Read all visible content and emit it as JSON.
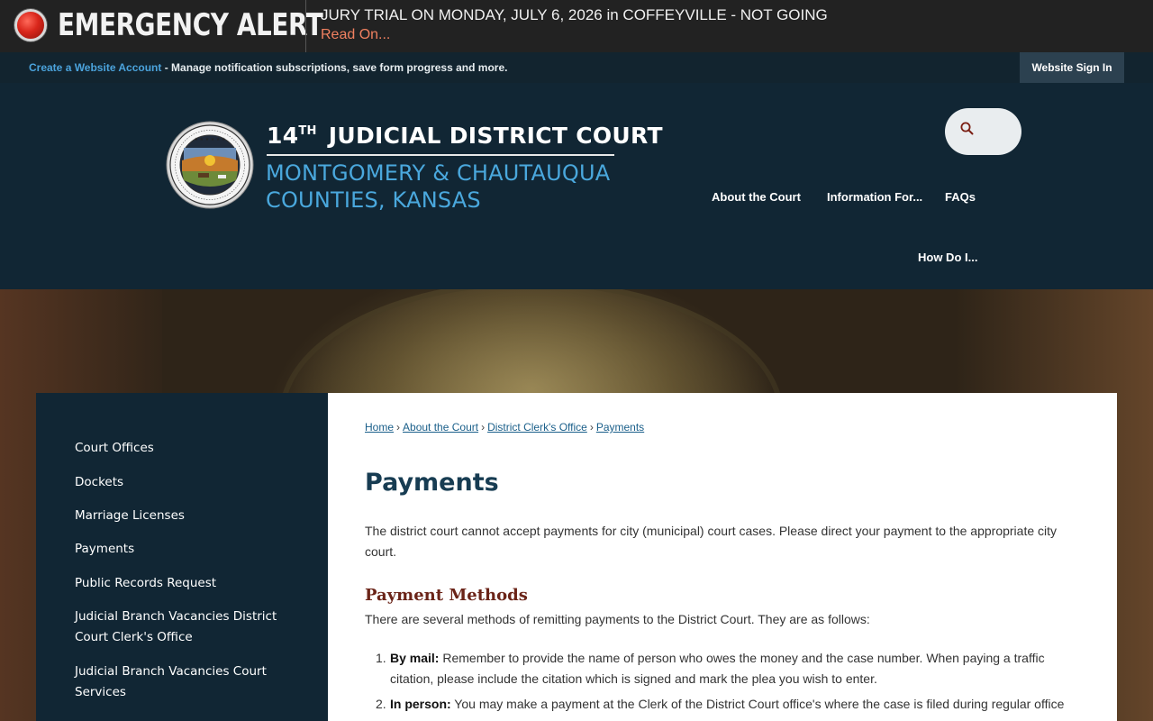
{
  "alert": {
    "title": "EMERGENCY ALERT",
    "headline": "JURY TRIAL ON MONDAY, JULY 6, 2026 in COFFEYVILLE - NOT GOING",
    "read_on": "Read On..."
  },
  "account_bar": {
    "create_link": "Create a Website Account",
    "description": " - Manage notification subscriptions, save form progress and more.",
    "sign_in": "Website Sign In"
  },
  "header": {
    "title_number": "14",
    "title_superscript": "TH",
    "title_rest": "JUDICIAL DISTRICT COURT",
    "county_line_1": "MONTGOMERY & CHAUTAUQUA",
    "county_line_2": "COUNTIES, KANSAS",
    "nav": [
      {
        "label": "About the Court"
      },
      {
        "label": "Information For..."
      },
      {
        "label": "FAQs"
      },
      {
        "label": "How Do I..."
      }
    ]
  },
  "sidebar": {
    "items": [
      {
        "label": "Court Offices"
      },
      {
        "label": "Dockets"
      },
      {
        "label": "Marriage Licenses"
      },
      {
        "label": "Payments"
      },
      {
        "label": "Public Records Request"
      },
      {
        "label": "Judicial Branch Vacancies District Court Clerk's Office"
      },
      {
        "label": "Judicial Branch Vacancies Court Services"
      }
    ]
  },
  "breadcrumb": {
    "items": [
      "Home",
      "About the Court",
      "District Clerk's Office",
      "Payments"
    ],
    "separator": "›"
  },
  "main": {
    "title": "Payments",
    "intro": "The district court cannot accept payments for city (municipal) court cases. Please direct your payment to the appropriate city court.",
    "section_heading": "Payment Methods",
    "section_intro": "There are several methods of remitting payments to the District Court. They are as follows:",
    "methods": [
      {
        "number": "1.",
        "label": "By mail:",
        "text": " Remember to provide the name of person who owes the money and the case number. When paying a traffic citation, please include the citation which is signed and mark the plea you wish to enter."
      },
      {
        "number": "2.",
        "label": "In person:",
        "text": " You may make a payment at the Clerk of the District Court office's where the case is filed during regular office"
      }
    ]
  },
  "colors": {
    "alert_bg": "#222222",
    "header_bg": "#112634",
    "county_blue": "#4aa8dd",
    "heading_red": "#6b2418",
    "title_navy": "#173c52",
    "link_blue": "#1a5f8a"
  },
  "icons": {
    "alert": "alert-circle-icon",
    "search": "search-icon",
    "seal": "kansas-state-seal"
  }
}
